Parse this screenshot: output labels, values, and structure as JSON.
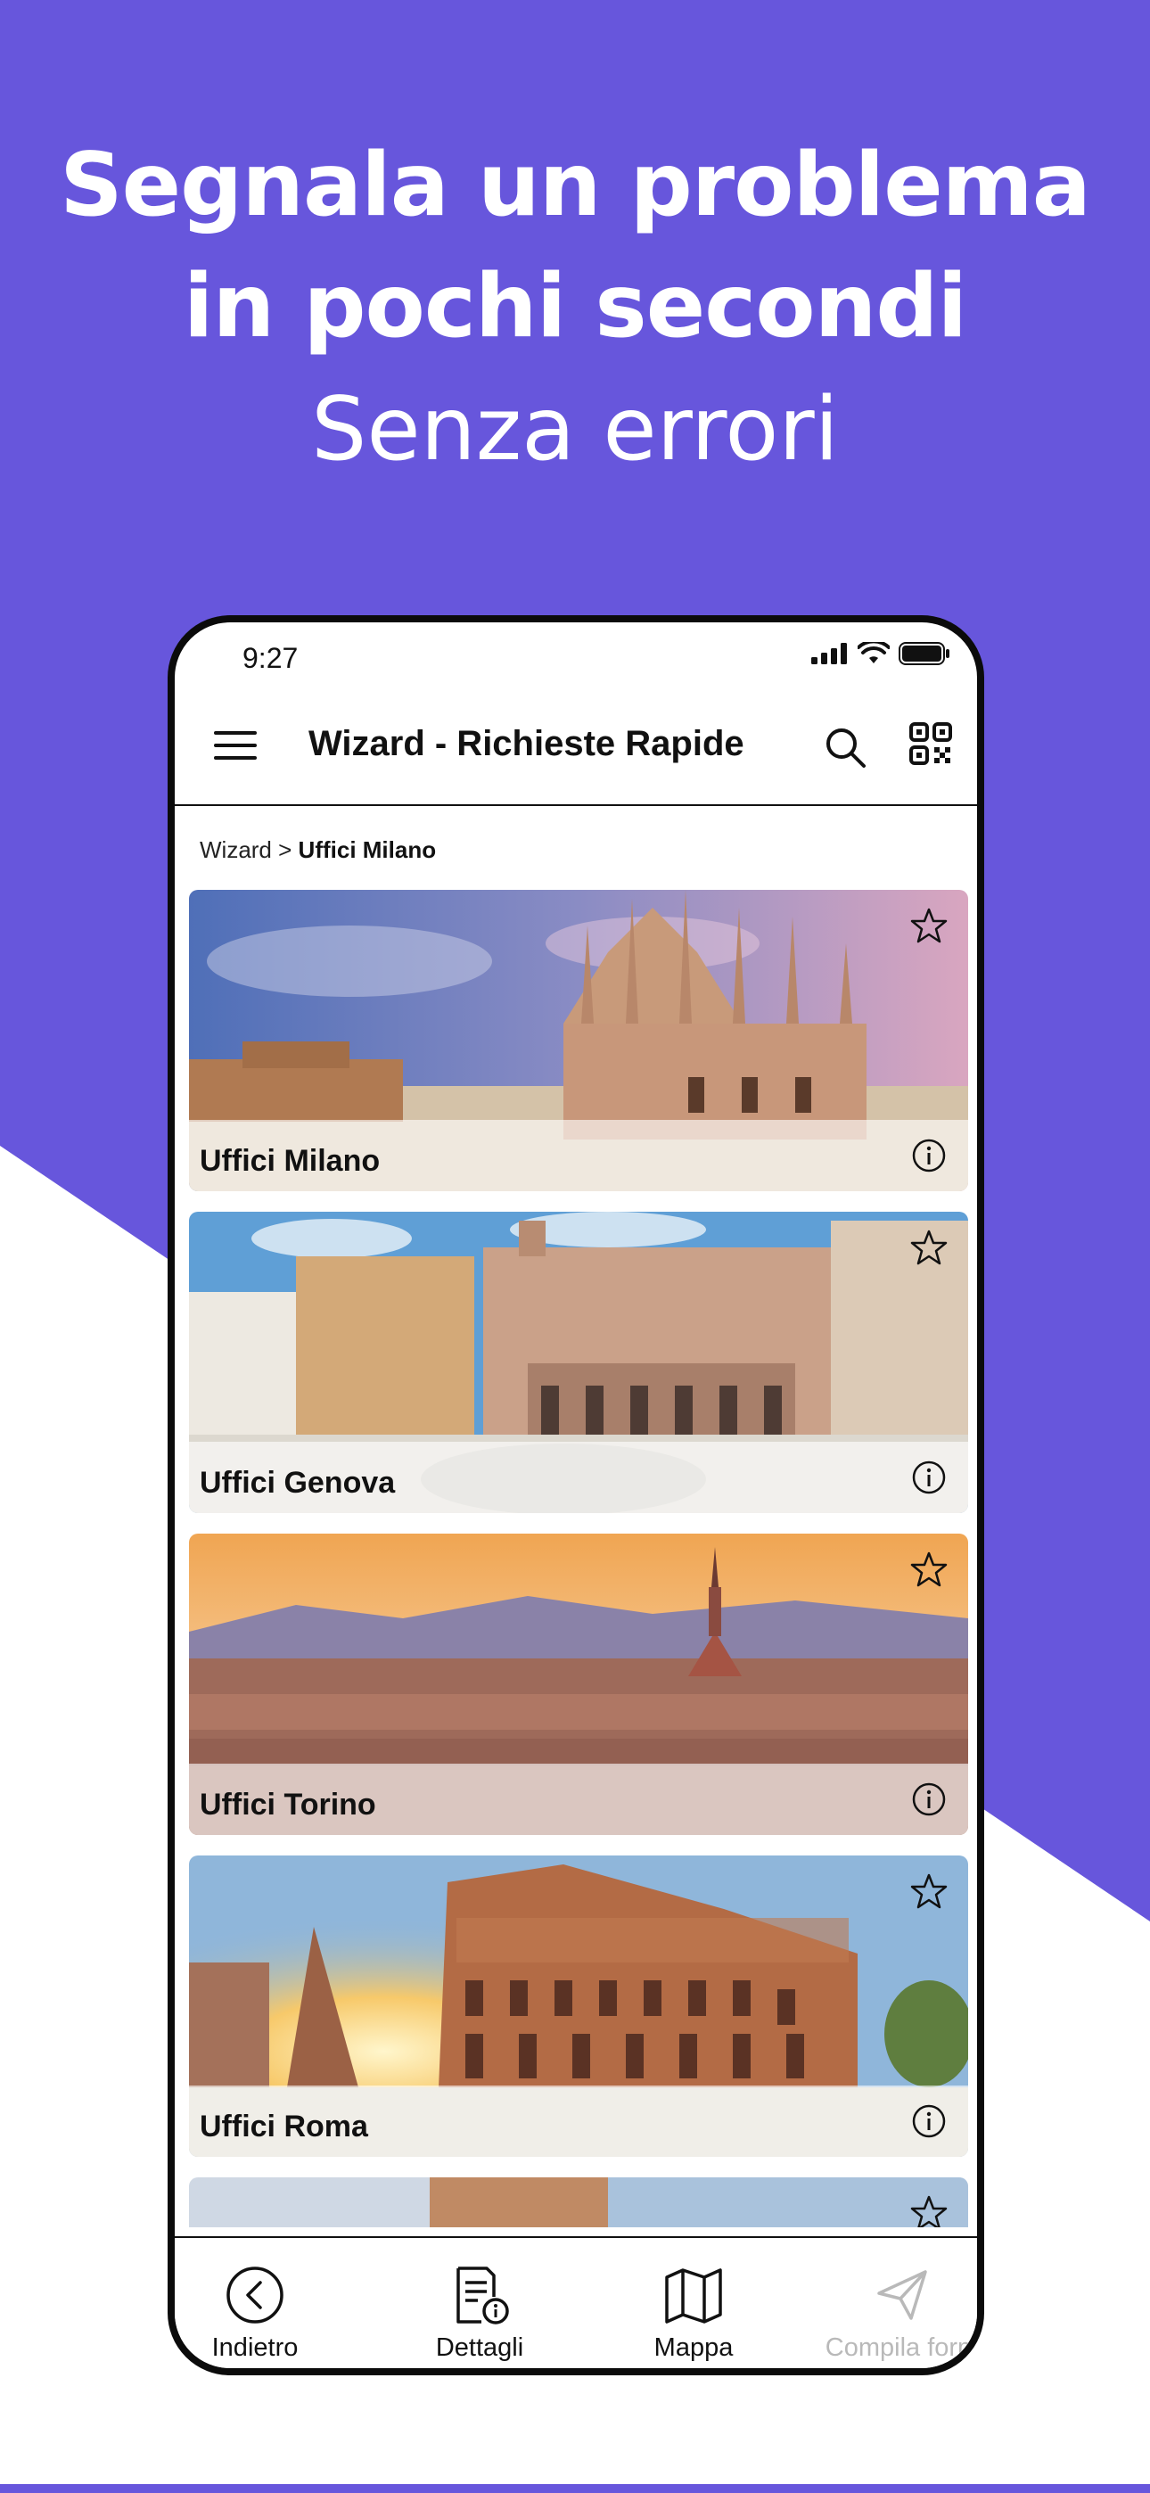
{
  "headline": {
    "line1": "Segnala un problema",
    "line2": "in pochi secondi",
    "line3": "Senza errori"
  },
  "status_bar": {
    "time": "9:27"
  },
  "app_bar": {
    "title": "Wizard - Richieste Rapide"
  },
  "breadcrumb": {
    "root": "Wizard",
    "separator": " > ",
    "current": "Uffici Milano"
  },
  "cards": [
    {
      "title": "Uffici Milano",
      "scene": "milan-cathedral"
    },
    {
      "title": "Uffici Genova",
      "scene": "genoa-square"
    },
    {
      "title": "Uffici Torino",
      "scene": "turin-skyline"
    },
    {
      "title": "Uffici Roma",
      "scene": "rome-colosseum"
    }
  ],
  "bottom_nav": [
    {
      "label": "Indietro",
      "icon": "back-circle-icon",
      "enabled": true
    },
    {
      "label": "Dettagli",
      "icon": "details-document-icon",
      "enabled": true
    },
    {
      "label": "Mappa",
      "icon": "map-icon",
      "enabled": true
    },
    {
      "label": "Compila form",
      "icon": "send-paper-plane-icon",
      "enabled": false
    }
  ],
  "colors": {
    "background": "#6756dc",
    "wedge": "#ffffff",
    "text": "#111111",
    "disabled": "#b9b9b9"
  }
}
